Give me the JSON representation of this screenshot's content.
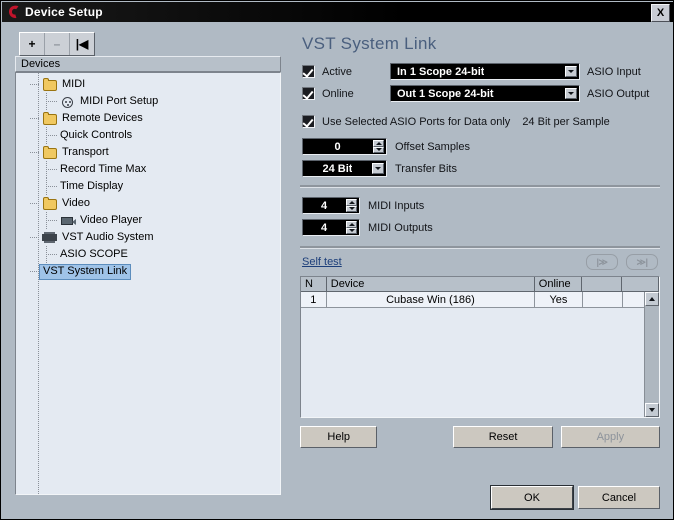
{
  "window": {
    "title": "Device Setup",
    "logo_icon": "cubase-logo-icon",
    "close_label": "X"
  },
  "tree_toolbar": {
    "add_label": "+",
    "remove_label": "–",
    "reset_label": "|◀"
  },
  "tree": {
    "header": "Devices",
    "nodes": [
      {
        "label": "MIDI",
        "icon": "folder-icon",
        "indent": 1,
        "selected": false
      },
      {
        "label": "MIDI Port Setup",
        "icon": "midi-port-icon",
        "indent": 2,
        "selected": false
      },
      {
        "label": "Remote Devices",
        "icon": "folder-icon",
        "indent": 1,
        "selected": false
      },
      {
        "label": "Quick Controls",
        "icon": "none",
        "indent": 2,
        "selected": false
      },
      {
        "label": "Transport",
        "icon": "folder-icon",
        "indent": 1,
        "selected": false
      },
      {
        "label": "Record Time Max",
        "icon": "none",
        "indent": 2,
        "selected": false
      },
      {
        "label": "Time Display",
        "icon": "none",
        "indent": 2,
        "selected": false
      },
      {
        "label": "Video",
        "icon": "folder-icon",
        "indent": 1,
        "selected": false
      },
      {
        "label": "Video Player",
        "icon": "video-camera-icon",
        "indent": 2,
        "selected": false
      },
      {
        "label": "VST Audio System",
        "icon": "audio-device-icon",
        "indent": 1,
        "selected": false
      },
      {
        "label": "ASIO SCOPE",
        "icon": "none",
        "indent": 2,
        "selected": false
      },
      {
        "label": "VST System Link",
        "icon": "none",
        "indent": 1,
        "selected": true
      }
    ]
  },
  "panel": {
    "title": "VST System Link",
    "accent_color": "#4a5f7e",
    "active": {
      "checked": true,
      "label": "Active",
      "value": "In 1 Scope 24-bit",
      "suffix": "ASIO Input"
    },
    "online": {
      "checked": true,
      "label": "Online",
      "value": "Out 1 Scope 24-bit",
      "suffix": "ASIO Output"
    },
    "data_only": {
      "checked": true,
      "label": "Use Selected ASIO Ports for Data only",
      "note": "24 Bit per Sample"
    },
    "offset_samples": {
      "value": "0",
      "label": "Offset Samples"
    },
    "transfer_bits": {
      "value": "24 Bit",
      "label": "Transfer Bits"
    },
    "midi_inputs": {
      "value": "4",
      "label": "MIDI Inputs"
    },
    "midi_outputs": {
      "value": "4",
      "label": "MIDI Outputs"
    },
    "self_test": {
      "link": "Self test",
      "nav_first": "|≫",
      "nav_last": "≫|"
    }
  },
  "table": {
    "columns": [
      "N",
      "Device",
      "Online",
      "",
      ""
    ],
    "rows": [
      [
        "1",
        "Cubase Win (186)",
        "Yes",
        "",
        ""
      ]
    ]
  },
  "buttons": {
    "help": "Help",
    "reset": "Reset",
    "apply": "Apply",
    "ok": "OK",
    "cancel": "Cancel"
  }
}
